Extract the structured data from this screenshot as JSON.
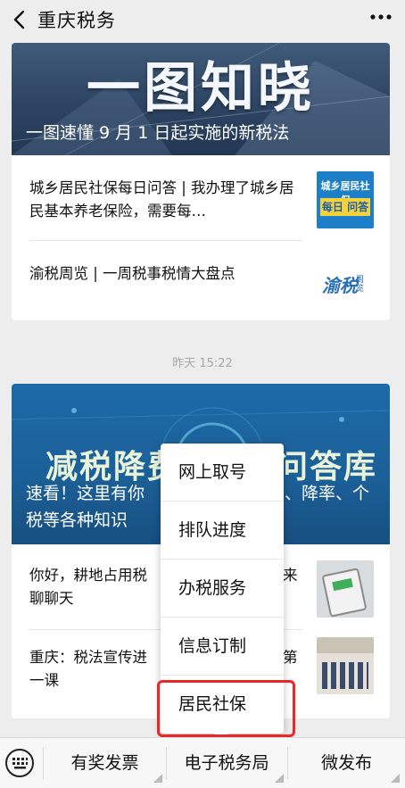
{
  "header": {
    "title": "重庆税务",
    "back_icon": "chevron-left-icon",
    "more_icon": "more-dots-icon"
  },
  "card1": {
    "banner_big": "一图知晓",
    "banner_caption": "一图速懂 9 月 1 日起实施的新税法",
    "articles": [
      {
        "title": "城乡居民社保每日问答 | 我办理了城乡居民基本养老保险，需要每…",
        "thumb": "城乡居民社保 每日问答",
        "thumb_line1": "城乡居民社保",
        "thumb_line2": "每日 问答"
      },
      {
        "title": "渝税周览 | 一周税事税情大盘点",
        "thumb_line1": "渝税",
        "thumb_line2": "周览"
      }
    ]
  },
  "timestamp": "昨天 15:22",
  "card2": {
    "banner_big_left": "减税降费",
    "banner_big_right": "问答库",
    "banner_caption_line1": "速看！这里有你",
    "banner_caption_line1_right": "、降率、个",
    "banner_caption_line2": "税等各种知识",
    "articles": [
      {
        "line1_left": "你好，耕地占用税",
        "line1_right": "来",
        "line2": "聊聊天"
      },
      {
        "line1_left": "重庆：税法宣传进",
        "line1_right": "第",
        "line2": "一课"
      }
    ]
  },
  "popup_menu": {
    "items": [
      "网上取号",
      "排队进度",
      "办税服务",
      "信息订制",
      "居民社保"
    ],
    "highlighted_index": 4
  },
  "bottom_bar": {
    "keyboard_icon": "keyboard-icon",
    "tabs": [
      "有奖发票",
      "电子税务局",
      "微发布"
    ]
  },
  "colors": {
    "background": "#ededed",
    "highlight_border": "#e8262b",
    "banner1": "#2d4462",
    "banner2": "#1b5f97"
  }
}
